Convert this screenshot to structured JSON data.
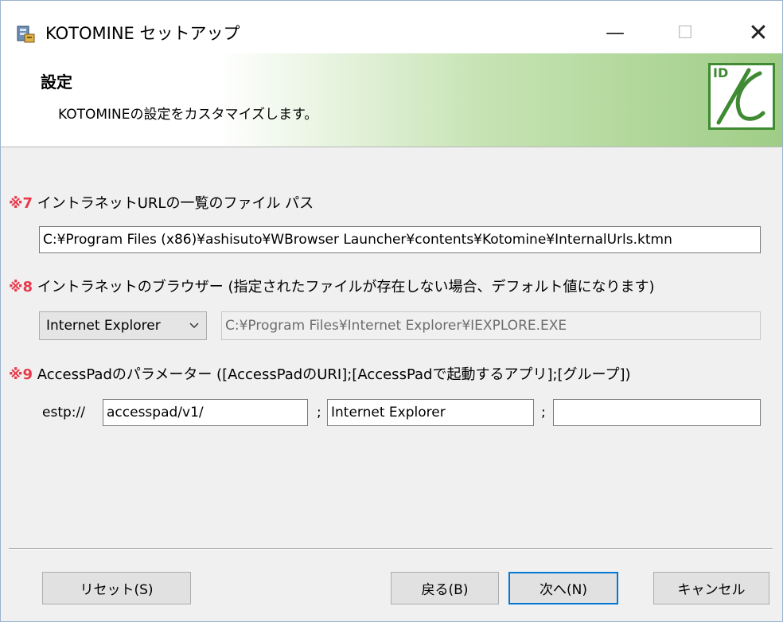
{
  "window": {
    "title": "KOTOMINE セットアップ",
    "minimize": "—",
    "maximize": "☐",
    "close": "✕"
  },
  "banner": {
    "title": "設定",
    "subtitle": "KOTOMINEの設定をカスタマイズします。",
    "logo_text": "ID"
  },
  "sections": {
    "s7": {
      "mark": "※7",
      "label": " イントラネットURLの一覧のファイル パス",
      "path_value": "C:¥Program Files (x86)¥ashisuto¥WBrowser Launcher¥contents¥Kotomine¥InternalUrls.ktmn"
    },
    "s8": {
      "mark": "※8",
      "label": " イントラネットのブラウザー (指定されたファイルが存在しない場合、デフォルト値になります)",
      "browser_selected": "Internet Explorer",
      "browser_path": "C:¥Program Files¥Internet Explorer¥IEXPLORE.EXE"
    },
    "s9": {
      "mark": "※9",
      "label": " AccessPadのパラメーター ([AccessPadのURI];[AccessPadで起動するアプリ];[グループ])",
      "scheme": "estp://",
      "uri_value": "accesspad/v1/",
      "separator1": ";",
      "app_value": "Internet Explorer",
      "separator2": ";",
      "group_value": ""
    }
  },
  "footer": {
    "reset": "リセット(S)",
    "back": "戻る(B)",
    "next": "次へ(N)",
    "cancel": "キャンセル"
  },
  "colors": {
    "accent_red": "#e8394a",
    "logo_green": "#3f8a32",
    "default_button_border": "#0078d7"
  },
  "icons": {
    "app": "setup-installer-icon",
    "dropdown": "chevron-down-icon"
  }
}
